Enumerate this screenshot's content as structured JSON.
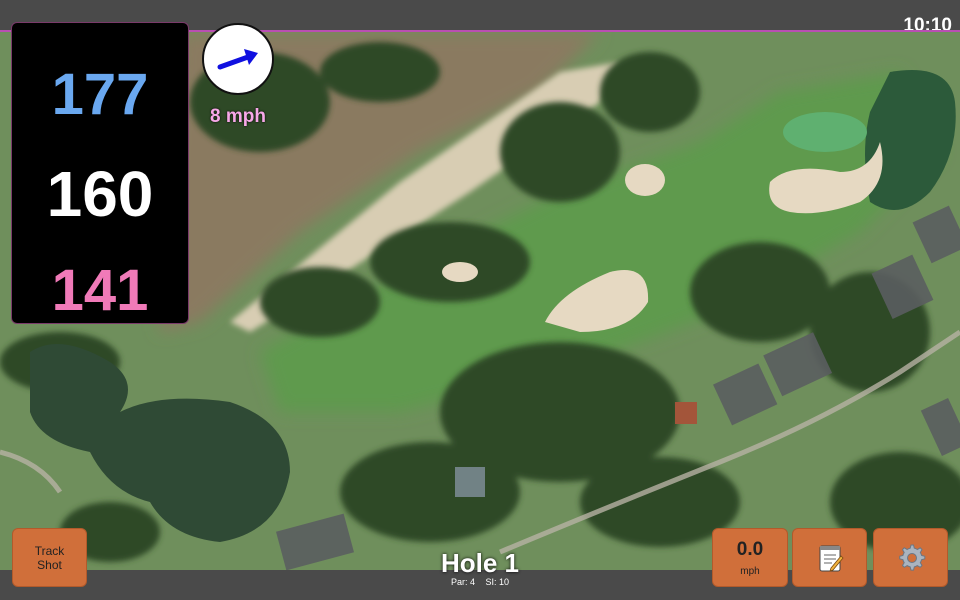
{
  "status_bar": {
    "time": "10:10"
  },
  "distances": {
    "back": "177",
    "middle": "160",
    "front": "141"
  },
  "wind": {
    "speed_label": "8 mph",
    "arrow_icon": "wind-arrow-icon",
    "direction": "east-northeast"
  },
  "hole": {
    "title": "Hole 1",
    "par_label": "Par: 4",
    "si_label": "SI: 10"
  },
  "buttons": {
    "track_shot_line1": "Track",
    "track_shot_line2": "Shot",
    "speed_value": "0.0",
    "speed_unit": "mph",
    "notes_icon": "notepad-icon",
    "settings_icon": "gear-icon"
  },
  "colors": {
    "back_distance": "#6aa8f0",
    "middle_distance": "#ffffff",
    "front_distance": "#f07ab8",
    "button": "#d06f3a",
    "wind_label": "#f7a8e8"
  }
}
